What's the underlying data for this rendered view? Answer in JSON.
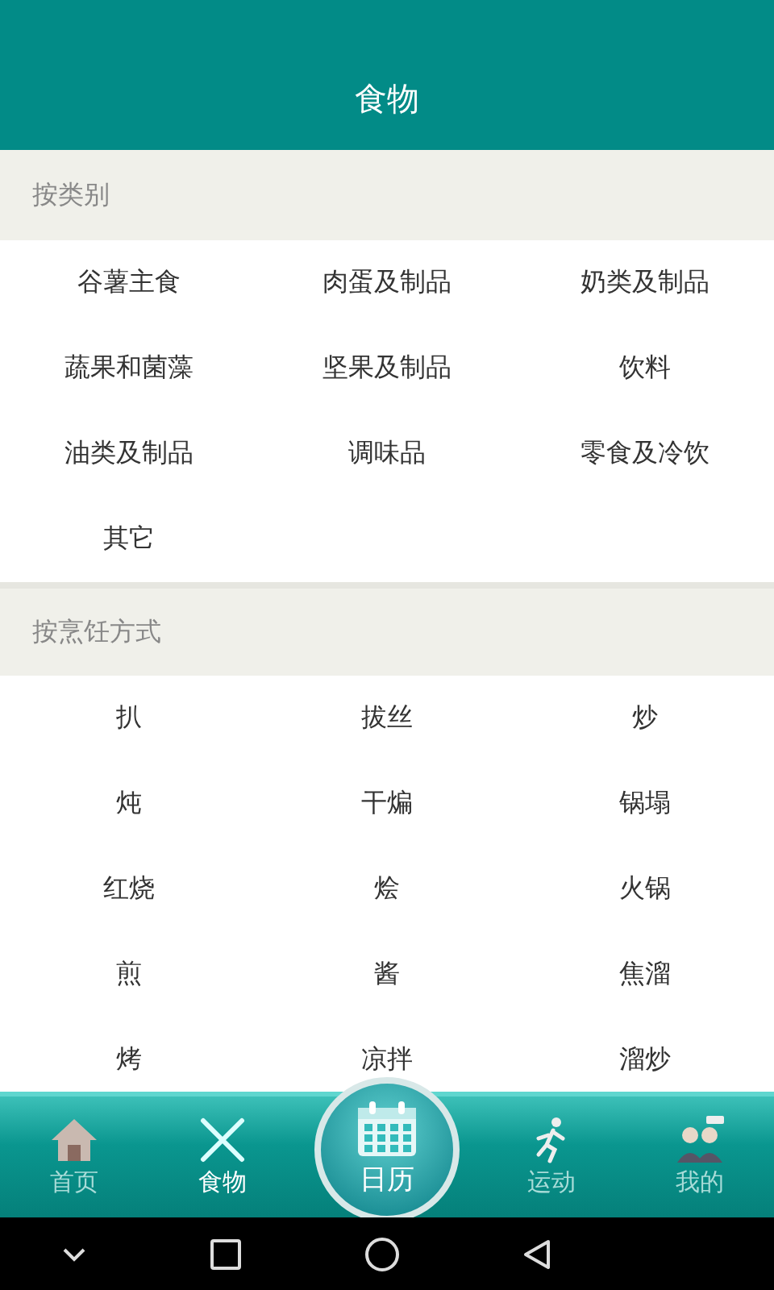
{
  "header": {
    "title": "食物"
  },
  "sections": [
    {
      "title": "按类别",
      "items": [
        "谷薯主食",
        "肉蛋及制品",
        "奶类及制品",
        "蔬果和菌藻",
        "坚果及制品",
        "饮料",
        "油类及制品",
        "调味品",
        "零食及冷饮",
        "其它"
      ]
    },
    {
      "title": "按烹饪方式",
      "items": [
        "扒",
        "拔丝",
        "炒",
        "炖",
        "干煸",
        "锅塌",
        "红烧",
        "烩",
        "火锅",
        "煎",
        "酱",
        "焦溜",
        "烤",
        "凉拌",
        "溜炒"
      ]
    }
  ],
  "nav": [
    {
      "label": "首页",
      "kind": "home",
      "selected": false
    },
    {
      "label": "食物",
      "kind": "food",
      "selected": true
    },
    {
      "label": "日历",
      "kind": "calendar",
      "selected": false
    },
    {
      "label": "运动",
      "kind": "run",
      "selected": false
    },
    {
      "label": "我的",
      "kind": "people",
      "selected": false
    }
  ]
}
